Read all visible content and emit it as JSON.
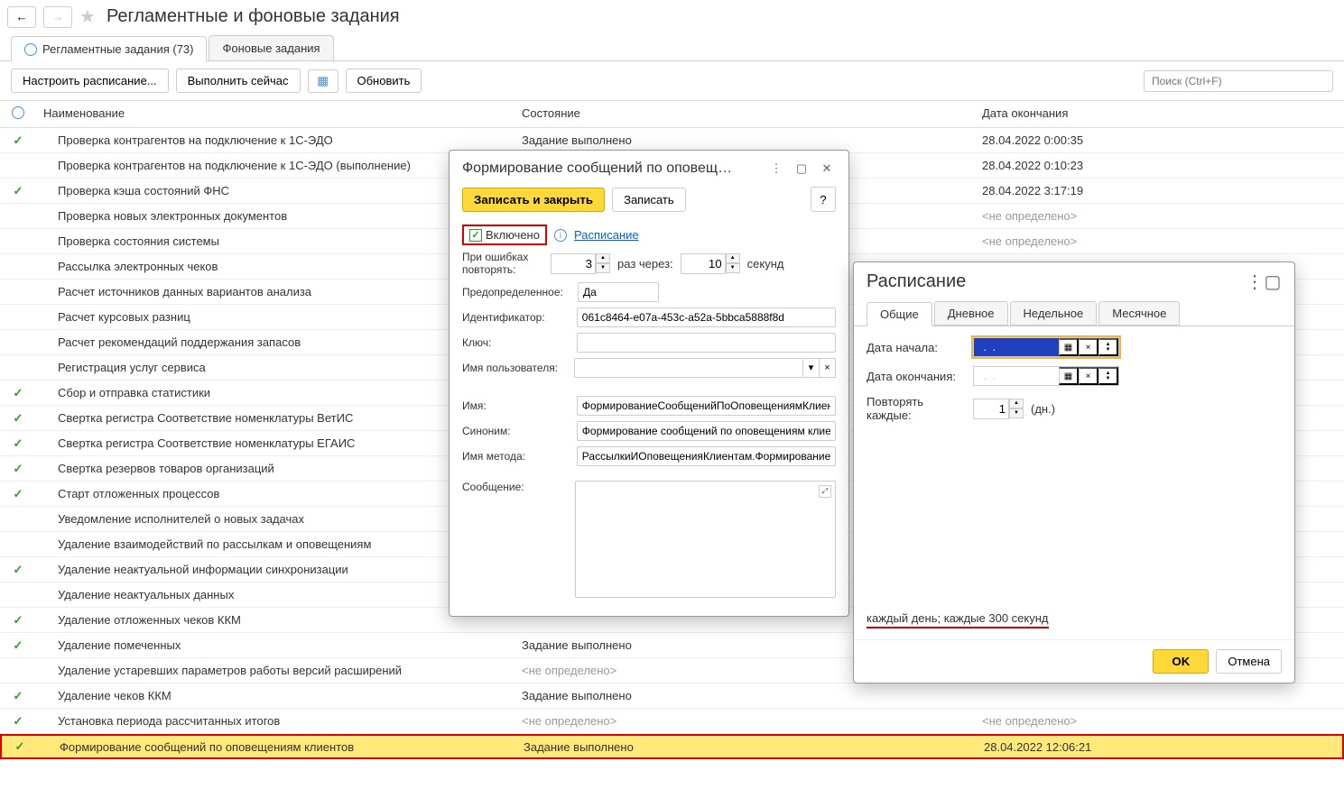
{
  "header": {
    "title": "Регламентные и фоновые задания"
  },
  "tabs": [
    {
      "label": "Регламентные задания (73)"
    },
    {
      "label": "Фоновые задания"
    }
  ],
  "toolbar": {
    "configure": "Настроить расписание...",
    "execute": "Выполнить сейчас",
    "refresh": "Обновить",
    "search_placeholder": "Поиск (Ctrl+F)"
  },
  "columns": {
    "name": "Наименование",
    "state": "Состояние",
    "date": "Дата окончания"
  },
  "rows": [
    {
      "check": true,
      "name": "Проверка контрагентов на подключение к 1С-ЭДО",
      "state": "Задание выполнено",
      "date": "28.04.2022 0:00:35"
    },
    {
      "check": false,
      "name": "Проверка контрагентов на подключение к 1С-ЭДО (выполнение)",
      "state": "",
      "date": "28.04.2022 0:10:23"
    },
    {
      "check": true,
      "name": "Проверка кэша состояний ФНС",
      "state": "",
      "date": "28.04.2022 3:17:19"
    },
    {
      "check": false,
      "name": "Проверка новых электронных документов",
      "state": "",
      "date": "<не определено>"
    },
    {
      "check": false,
      "name": "Проверка состояния системы",
      "state": "",
      "date": "<не определено>"
    },
    {
      "check": false,
      "name": "Рассылка электронных чеков",
      "state": "",
      "date": "<не определено>"
    },
    {
      "check": false,
      "name": "Расчет источников данных вариантов анализа",
      "state": "",
      "date": ""
    },
    {
      "check": false,
      "name": "Расчет курсовых разниц",
      "state": "",
      "date": ""
    },
    {
      "check": false,
      "name": "Расчет рекомендаций поддержания запасов",
      "state": "",
      "date": ""
    },
    {
      "check": false,
      "name": "Регистрация услуг сервиса",
      "state": "",
      "date": ""
    },
    {
      "check": true,
      "name": "Сбор и отправка статистики",
      "state": "",
      "date": ""
    },
    {
      "check": true,
      "name": "Свертка регистра Соответствие номенклатуры ВетИС",
      "state": "",
      "date": ""
    },
    {
      "check": true,
      "name": "Свертка регистра Соответствие номенклатуры ЕГАИС",
      "state": "",
      "date": ""
    },
    {
      "check": true,
      "name": "Свертка резервов товаров организаций",
      "state": "",
      "date": ""
    },
    {
      "check": true,
      "name": "Старт отложенных процессов",
      "state": "",
      "date": ""
    },
    {
      "check": false,
      "name": "Уведомление исполнителей о новых задачах",
      "state": "",
      "date": ""
    },
    {
      "check": false,
      "name": "Удаление взаимодействий по рассылкам и оповещениям",
      "state": "",
      "date": ""
    },
    {
      "check": true,
      "name": "Удаление неактуальной информации синхронизации",
      "state": "",
      "date": ""
    },
    {
      "check": false,
      "name": "Удаление неактуальных данных",
      "state": "",
      "date": ""
    },
    {
      "check": true,
      "name": "Удаление отложенных чеков ККМ",
      "state": "",
      "date": ""
    },
    {
      "check": true,
      "name": "Удаление помеченных",
      "state": "Задание выполнено",
      "date": ""
    },
    {
      "check": false,
      "name": "Удаление устаревших параметров работы версий расширений",
      "state": "<не определено>",
      "date": "<не определено>"
    },
    {
      "check": true,
      "name": "Удаление чеков ККМ",
      "state": "Задание выполнено",
      "date": ""
    },
    {
      "check": true,
      "name": "Установка периода рассчитанных итогов",
      "state": "<не определено>",
      "date": "<не определено>"
    },
    {
      "check": true,
      "name": "Формирование сообщений по оповещениям клиентов",
      "state": "Задание выполнено",
      "date": "28.04.2022 12:06:21",
      "selected": true
    }
  ],
  "dialog1": {
    "title": "Формирование сообщений по оповещ…",
    "save_close": "Записать и закрыть",
    "save": "Записать",
    "enabled_label": "Включено",
    "schedule_link": "Расписание",
    "errors_label": "При ошибках повторять:",
    "retry_count": "3",
    "times_through": "раз через:",
    "retry_sec": "10",
    "seconds": "секунд",
    "predef_label": "Предопределенное:",
    "predef_val": "Да",
    "id_label": "Идентификатор:",
    "id_val": "061c8464-e07a-453c-a52a-5bbca5888f8d",
    "key_label": "Ключ:",
    "key_val": "",
    "user_label": "Имя пользователя:",
    "name_label": "Имя:",
    "name_val": "ФормированиеСообщенийПоОповещениямКлиентс",
    "synonym_label": "Синоним:",
    "synonym_val": "Формирование сообщений по оповещениям клиент",
    "method_label": "Имя метода:",
    "method_val": "РассылкиИОповещенияКлиентам.ФормированиеСс",
    "message_label": "Сообщение:"
  },
  "dialog2": {
    "title": "Расписание",
    "tabs": {
      "general": "Общие",
      "daily": "Дневное",
      "weekly": "Недельное",
      "monthly": "Месячное"
    },
    "start_date_label": "Дата начала:",
    "start_date_val": "  .  .    ",
    "end_date_label": "Дата окончания:",
    "end_date_val": "  .  .    ",
    "repeat_label": "Повторять каждые:",
    "repeat_val": "1",
    "repeat_unit": "(дн.)",
    "summary": "каждый день; каждые 300 секунд",
    "ok": "OK",
    "cancel": "Отмена"
  }
}
